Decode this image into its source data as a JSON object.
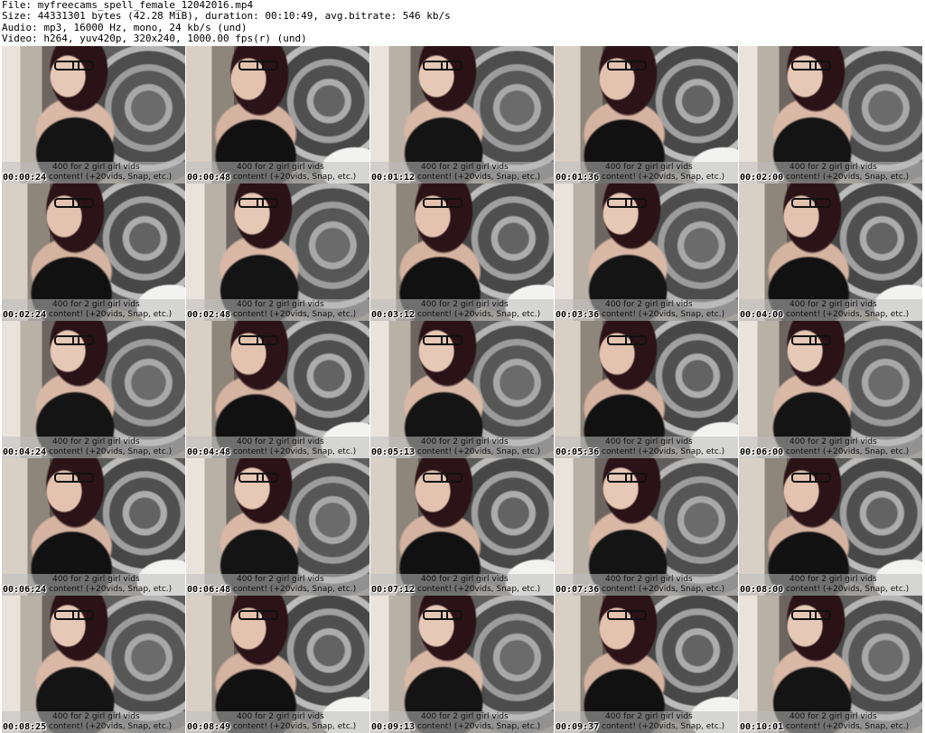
{
  "header": {
    "file_line": "File: myfreecams_spell_female_12042016.mp4",
    "size_line": "Size: 44331301 bytes (42.28 MiB), duration: 00:10:49, avg.bitrate: 546 kb/s",
    "audio_line": "Audio: mp3, 16000 Hz, mono, 24 kb/s (und)",
    "video_line": "Video: h264, yuv420p, 320x240, 1000.00 fps(r) (und)"
  },
  "overlay": {
    "line1": "400 for 2 girl girl vids",
    "line2": "content! (+20vids, Snap, etc.)"
  },
  "frames": [
    {
      "time": "00:00:24"
    },
    {
      "time": "00:00:48"
    },
    {
      "time": "00:01:12"
    },
    {
      "time": "00:01:36"
    },
    {
      "time": "00:02:00"
    },
    {
      "time": "00:02:24"
    },
    {
      "time": "00:02:48"
    },
    {
      "time": "00:03:12"
    },
    {
      "time": "00:03:36"
    },
    {
      "time": "00:04:00"
    },
    {
      "time": "00:04:24"
    },
    {
      "time": "00:04:48"
    },
    {
      "time": "00:05:13"
    },
    {
      "time": "00:05:36"
    },
    {
      "time": "00:06:00"
    },
    {
      "time": "00:06:24"
    },
    {
      "time": "00:06:48"
    },
    {
      "time": "00:07:12"
    },
    {
      "time": "00:07:36"
    },
    {
      "time": "00:08:00"
    },
    {
      "time": "00:08:25"
    },
    {
      "time": "00:08:49"
    },
    {
      "time": "00:09:13"
    },
    {
      "time": "00:09:37"
    },
    {
      "time": "00:10:01"
    }
  ]
}
